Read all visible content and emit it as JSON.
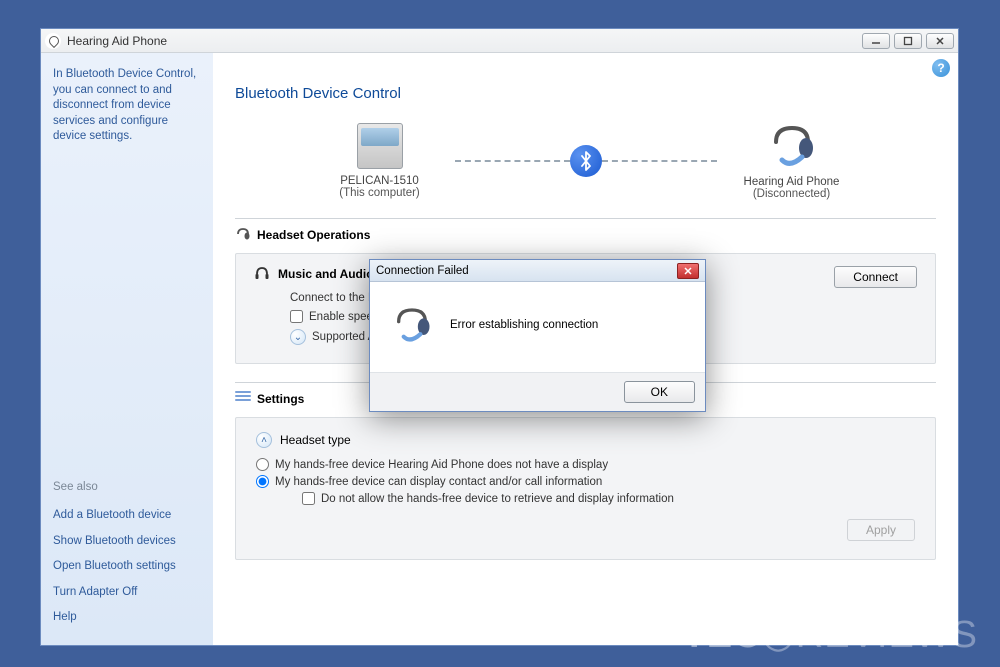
{
  "window": {
    "title": "Hearing Aid Phone"
  },
  "sidebar": {
    "intro": "In Bluetooth Device Control, you can connect to and disconnect from device services and configure device settings.",
    "see_also": "See also",
    "links": [
      "Add a Bluetooth device",
      "Show Bluetooth devices",
      "Open Bluetooth settings",
      "Turn Adapter Off",
      "Help"
    ]
  },
  "main": {
    "page_title": "Bluetooth Device Control",
    "computer_name": "PELICAN-1510",
    "computer_sub": "(This computer)",
    "remote_name": "Hearing Aid Phone",
    "remote_sub": "(Disconnected)",
    "headset_ops_header": "Headset Operations",
    "music_audio_header": "Music and Audio",
    "connect_line": "Connect to the B",
    "enable_speech": "Enable spee",
    "supported": "Supported A",
    "connect_btn": "Connect",
    "settings_header": "Settings",
    "headset_type": "Headset type",
    "radio1": "My hands-free device Hearing Aid Phone does not have a display",
    "radio2": "My hands-free device can display contact and/or call information",
    "checkbox_sub": "Do not allow the hands-free device to retrieve and display information",
    "apply": "Apply"
  },
  "dialog": {
    "title": "Connection Failed",
    "message": "Error establishing connection",
    "ok": "OK"
  },
  "watermark": "TECOREVIEWS"
}
